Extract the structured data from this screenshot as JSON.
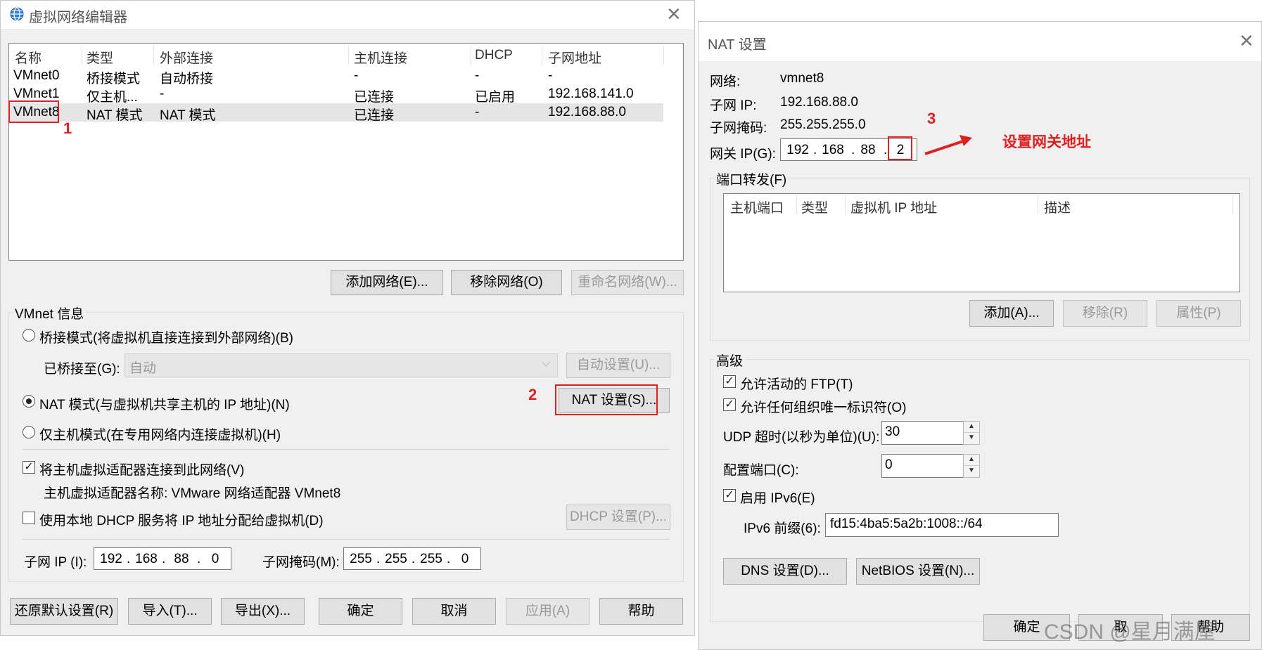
{
  "left_window": {
    "title": "虚拟网络编辑器",
    "columns": [
      "名称",
      "类型",
      "外部连接",
      "主机连接",
      "DHCP",
      "子网地址"
    ],
    "rows": [
      {
        "name": "VMnet0",
        "type": "桥接模式",
        "external": "自动桥接",
        "host": "-",
        "dhcp": "-",
        "subnet": "-"
      },
      {
        "name": "VMnet1",
        "type": "仅主机...",
        "external": "-",
        "host": "已连接",
        "dhcp": "已启用",
        "subnet": "192.168.141.0"
      },
      {
        "name": "VMnet8",
        "type": "NAT 模式",
        "external": "NAT 模式",
        "host": "已连接",
        "dhcp": "-",
        "subnet": "192.168.88.0"
      }
    ],
    "buttons": {
      "add_network": "添加网络(E)...",
      "remove_network": "移除网络(O)",
      "rename_network": "重命名网络(W)..."
    },
    "vmnet_info": {
      "legend": "VMnet 信息",
      "bridge_mode": "桥接模式(将虚拟机直接连接到外部网络)(B)",
      "bridged_to_label": "已桥接至(G):",
      "bridged_to_value": "自动",
      "auto_settings": "自动设置(U)...",
      "nat_mode": "NAT 模式(与虚拟机共享主机的 IP 地址)(N)",
      "nat_settings": "NAT 设置(S)...",
      "host_only_mode": "仅主机模式(在专用网络内连接虚拟机)(H)",
      "connect_adapter": "将主机虚拟适配器连接到此网络(V)",
      "adapter_name": "主机虚拟适配器名称: VMware 网络适配器 VMnet8",
      "use_dhcp": "使用本地 DHCP 服务将 IP 地址分配给虚拟机(D)",
      "dhcp_settings": "DHCP 设置(P)...",
      "subnet_ip_label": "子网 IP (I):",
      "subnet_ip": [
        "192",
        "168",
        "88",
        "0"
      ],
      "subnet_mask_label": "子网掩码(M):",
      "subnet_mask": [
        "255",
        "255",
        "255",
        "0"
      ]
    },
    "footer": {
      "restore": "还原默认设置(R)",
      "import": "导入(T)...",
      "export": "导出(X)...",
      "ok": "确定",
      "cancel": "取消",
      "apply": "应用(A)",
      "help": "帮助"
    }
  },
  "right_window": {
    "title": "NAT 设置",
    "network_label": "网络:",
    "network_value": "vmnet8",
    "subnet_ip_label": "子网 IP:",
    "subnet_ip_value": "192.168.88.0",
    "subnet_mask_label": "子网掩码:",
    "subnet_mask_value": "255.255.255.0",
    "gateway_label": "网关 IP(G):",
    "gateway_ip": [
      "192",
      "168",
      "88",
      "2"
    ],
    "port_forwarding": {
      "legend": "端口转发(F)",
      "columns": [
        "主机端口",
        "类型",
        "虚拟机 IP 地址",
        "描述"
      ],
      "add": "添加(A)...",
      "remove": "移除(R)",
      "properties": "属性(P)"
    },
    "advanced": {
      "legend": "高级",
      "allow_ftp": "允许活动的 FTP(T)",
      "allow_org_id": "允许任何组织唯一标识符(O)",
      "udp_timeout_label": "UDP 超时(以秒为单位)(U):",
      "udp_timeout_value": "30",
      "config_port_label": "配置端口(C):",
      "config_port_value": "0",
      "enable_ipv6": "启用 IPv6(E)",
      "ipv6_prefix_label": "IPv6 前缀(6):",
      "ipv6_prefix_value": "fd15:4ba5:5a2b:1008::/64",
      "dns_settings": "DNS 设置(D)...",
      "netbios_settings": "NetBIOS 设置(N)..."
    },
    "footer": {
      "ok": "确定",
      "cancel_partial": "取",
      "help_partial": "帮助"
    }
  },
  "annotations": {
    "step1": "1",
    "step2": "2",
    "step3": "3",
    "gateway_note": "设置网关地址",
    "watermark": "CSDN @星月满屋"
  },
  "colors": {
    "annotation_red": "#e02020",
    "window_bg": "#f0f0f0",
    "selected_row": "#e5e5e5"
  }
}
